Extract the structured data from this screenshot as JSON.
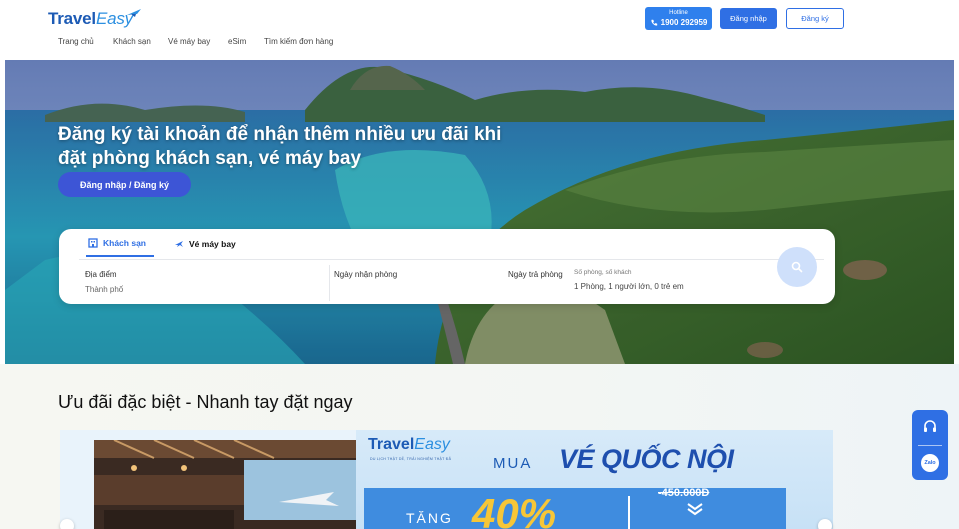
{
  "brand": {
    "logo_part1": "Travel",
    "logo_part2": "Easy"
  },
  "nav": {
    "items": [
      {
        "label": "Trang chủ"
      },
      {
        "label": "Khách sạn"
      },
      {
        "label": "Vé máy bay"
      },
      {
        "label": "eSim"
      },
      {
        "label": "Tìm kiếm đơn hàng"
      }
    ]
  },
  "header": {
    "hotline_label": "Hotline",
    "hotline_number": "1900 292959",
    "login_label": "Đăng nhập",
    "register_label": "Đăng ký"
  },
  "hero": {
    "title_line1": "Đăng ký tài khoản để nhận thêm nhiều ưu đãi khi",
    "title_line2": "đặt phòng khách sạn, vé máy bay",
    "cta_label": "Đăng nhập / Đăng ký"
  },
  "search": {
    "tabs": [
      {
        "label": "Khách sạn",
        "icon": "hotel-icon",
        "active": true
      },
      {
        "label": "Vé máy bay",
        "icon": "plane-icon",
        "active": false
      }
    ],
    "location_label": "Địa điểm",
    "location_placeholder": "Thành phố",
    "checkin_label": "Ngày nhận phòng",
    "checkout_label": "Ngày trả phòng",
    "guests_label": "Số phòng, số khách",
    "guests_value": "1 Phòng, 1 người lớn, 0 trẻ em"
  },
  "deals": {
    "title": "Ưu đãi đặc biệt - Nhanh tay đặt ngay",
    "banner": {
      "logo_part1": "Travel",
      "logo_part2": "Easy",
      "logo_sub": "DU LỊCH THẬT DỄ, TRẢI NGHIỆM THẬT ĐÃ",
      "mua": "MUA",
      "headline": "VÉ QUỐC NỘI",
      "tang": "TĂNG",
      "discount": "40%",
      "old_price": "-450.000Đ"
    }
  },
  "widgets": {
    "support_icon": "headset-icon",
    "zalo_label": "Zalo"
  },
  "colors": {
    "primary": "#2f6fe4",
    "hero_button": "#3d55d6",
    "accent_yellow": "#f7c637"
  }
}
